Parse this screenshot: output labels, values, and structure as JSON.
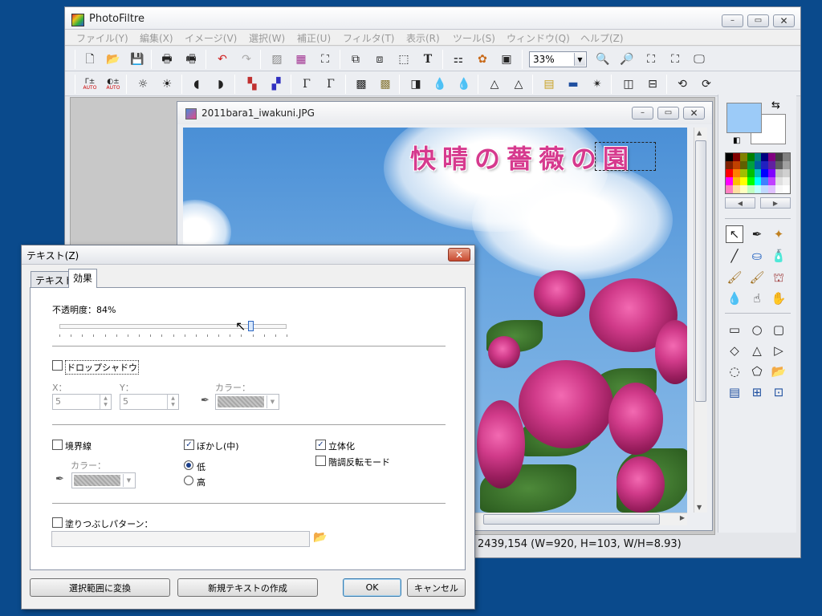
{
  "main_window": {
    "title": "PhotoFiltre",
    "controls": {
      "minimize": "–",
      "maximize": "▭",
      "close": "✕"
    }
  },
  "menu": [
    "ファイル(Y)",
    "編集(X)",
    "イメージ(V)",
    "選択(W)",
    "補正(U)",
    "フィルタ(T)",
    "表示(R)",
    "ツール(S)",
    "ウィンドウ(Q)",
    "ヘルプ(Z)"
  ],
  "toolbar": {
    "zoom_value": "33%",
    "auto_label": "AUTO"
  },
  "image_window": {
    "title": "2011bara1_iwakuni.JPG",
    "caption": "快晴の薔薇の園"
  },
  "status": {
    "text": "2439,154 (W=920, H=103, W/H=8.93)"
  },
  "colors": {
    "foreground": "#9ccbf8",
    "background": "#ffffff",
    "caption_color": "#d63a8e"
  },
  "dialog": {
    "title": "テキスト(Z)",
    "close": "✕",
    "tabs": [
      "テキスト",
      "効果"
    ],
    "active_tab": 1,
    "opacity": {
      "label": "不透明度：84%",
      "value": 84
    },
    "drop_shadow": {
      "label": "ドロップシャドウ",
      "checked": false
    },
    "x": {
      "label": "X：",
      "value": "5"
    },
    "y": {
      "label": "Y：",
      "value": "5"
    },
    "shadow_color_label": "カラー：",
    "border": {
      "label": "境界線",
      "checked": false
    },
    "border_color_label": "カラー：",
    "blur": {
      "label": "ぼかし(中)",
      "checked": true
    },
    "blur_low": {
      "label": "低",
      "selected": true
    },
    "blur_high": {
      "label": "高",
      "selected": false
    },
    "emboss": {
      "label": "立体化",
      "checked": true
    },
    "invert": {
      "label": "階調反転モード",
      "checked": false
    },
    "fill_pattern": {
      "label": "塗りつぶしパターン：",
      "checked": false
    },
    "buttons": {
      "convert": "選択範囲に変換",
      "new_text": "新規テキストの作成",
      "ok": "OK",
      "cancel": "キャンセル"
    }
  }
}
